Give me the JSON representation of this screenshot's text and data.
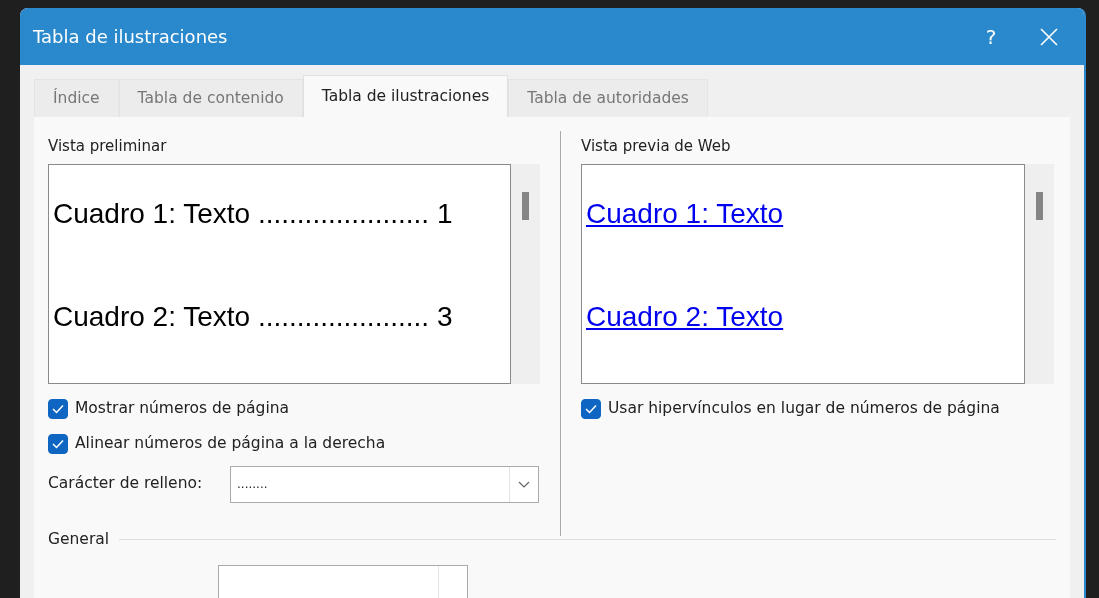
{
  "window": {
    "title": "Tabla de ilustraciones",
    "help": "?"
  },
  "tabs": [
    {
      "label": "Índice",
      "selected": false
    },
    {
      "label": "Tabla de contenido",
      "selected": false
    },
    {
      "label": "Tabla de ilustraciones",
      "selected": true
    },
    {
      "label": "Tabla de autoridades",
      "selected": false
    }
  ],
  "print_preview": {
    "label": "Vista preliminar",
    "entries": [
      {
        "text": "Cuadro 1: Texto ......................",
        "page": "1"
      },
      {
        "text": "Cuadro 2: Texto ......................",
        "page": "3"
      }
    ]
  },
  "web_preview": {
    "label": "Vista previa de Web",
    "entries": [
      {
        "text": "Cuadro 1: Texto"
      },
      {
        "text": "Cuadro 2: Texto"
      }
    ]
  },
  "options_left": [
    {
      "label": "Mostrar números de página",
      "checked": true
    },
    {
      "label": "Alinear números de página a la derecha",
      "checked": true
    }
  ],
  "options_right": [
    {
      "label": "Usar hipervínculos en lugar de números de página",
      "checked": true
    }
  ],
  "tab_leader": {
    "label": "Carácter de relleno:",
    "value": "........"
  },
  "general": {
    "label": "General"
  }
}
